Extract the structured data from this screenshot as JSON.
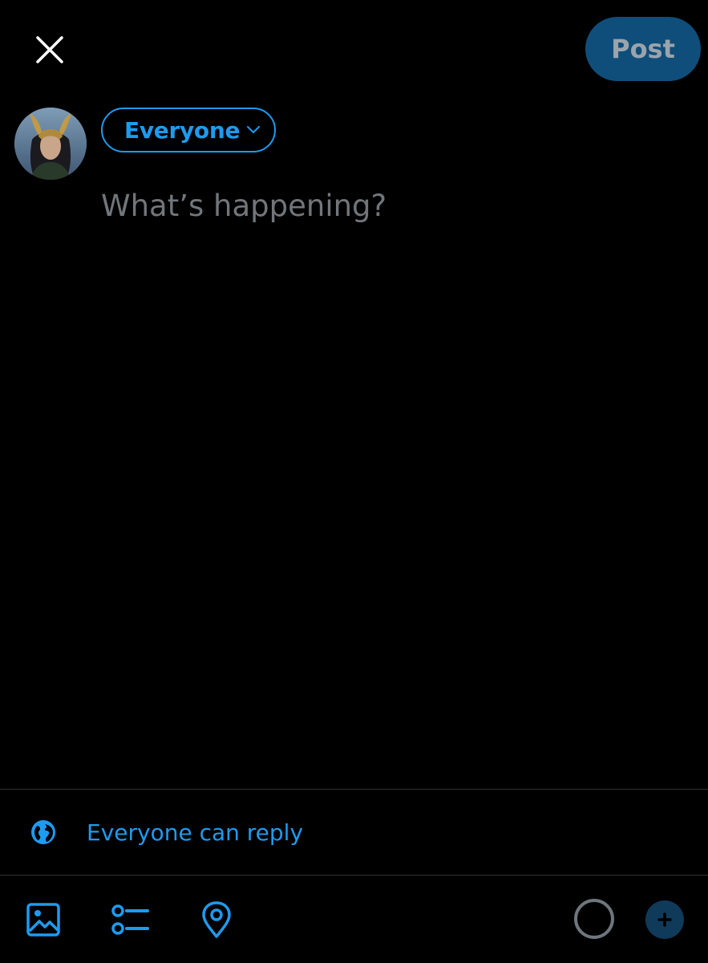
{
  "header": {
    "close_icon": "close-icon",
    "post_label": "Post"
  },
  "composer": {
    "avatar": "user-avatar",
    "audience_label": "Everyone",
    "audience_icon": "chevron-down-icon",
    "placeholder": "What’s happening?"
  },
  "reply_setting": {
    "icon": "globe-icon",
    "label": "Everyone can reply"
  },
  "toolbar": {
    "items": [
      "image-icon",
      "poll-icon",
      "location-icon"
    ],
    "counter": "character-counter-ring",
    "add_icon": "add-thread-icon"
  },
  "colors": {
    "background": "#000000",
    "accent": "#1d9bf0",
    "post_button_bg": "#0f4e7a",
    "post_button_text": "#9aa4ad",
    "placeholder": "#71767b",
    "divider": "#2f3336"
  }
}
